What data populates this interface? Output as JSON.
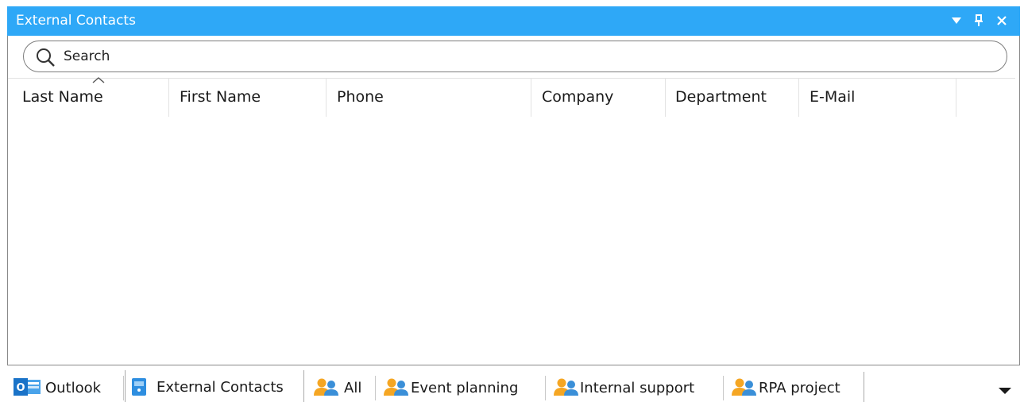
{
  "panel": {
    "title": "External Contacts",
    "controls": {
      "dropdown": "window-position-dropdown-icon",
      "pin": "pin-icon",
      "close": "close-icon"
    }
  },
  "search": {
    "placeholder": "Search",
    "value": ""
  },
  "columns": [
    {
      "label": "Last Name",
      "sorted": "ascending"
    },
    {
      "label": "First Name"
    },
    {
      "label": "Phone"
    },
    {
      "label": "Company"
    },
    {
      "label": "Department"
    },
    {
      "label": "E-Mail"
    }
  ],
  "rows": [],
  "tabs": [
    {
      "label": "Outlook",
      "icon": "outlook-icon",
      "active": false
    },
    {
      "label": "External Contacts",
      "icon": "address-book-icon",
      "active": true
    },
    {
      "label": "All",
      "icon": "group-icon",
      "active": false
    },
    {
      "label": "Event planning",
      "icon": "group-icon",
      "active": false
    },
    {
      "label": "Internal support",
      "icon": "group-icon",
      "active": false
    },
    {
      "label": "RPA project",
      "icon": "group-icon",
      "active": false
    }
  ],
  "colors": {
    "titlebar": "#2ea8f7",
    "outlook_blue": "#1a73c8",
    "group_orange": "#f5a623",
    "group_blue": "#3a8fd8"
  }
}
